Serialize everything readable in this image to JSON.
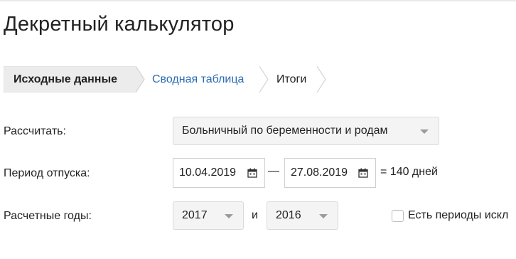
{
  "page": {
    "title": "Декретный калькулятор"
  },
  "steps": [
    {
      "label": "Исходные данные",
      "state": "active"
    },
    {
      "label": "Сводная таблица",
      "state": "link"
    },
    {
      "label": "Итоги",
      "state": "default"
    }
  ],
  "form": {
    "calculate": {
      "label": "Рассчитать:",
      "value": "Больничный по беременности и родам"
    },
    "period": {
      "label": "Период отпуска:",
      "start": "10.04.2019",
      "separator": "—",
      "end": "27.08.2019",
      "total": "= 140 дней"
    },
    "years": {
      "label": "Расчетные годы:",
      "year1": "2017",
      "conjunction": "и",
      "year2": "2016",
      "checkbox_label": "Есть периоды искл",
      "checkbox_checked": false
    }
  },
  "colors": {
    "link": "#2a6db3",
    "active_step_bg": "#ececec",
    "select_bg": "#f4f4f4"
  },
  "icons": [
    "calendar-icon",
    "chevron-down-icon"
  ]
}
